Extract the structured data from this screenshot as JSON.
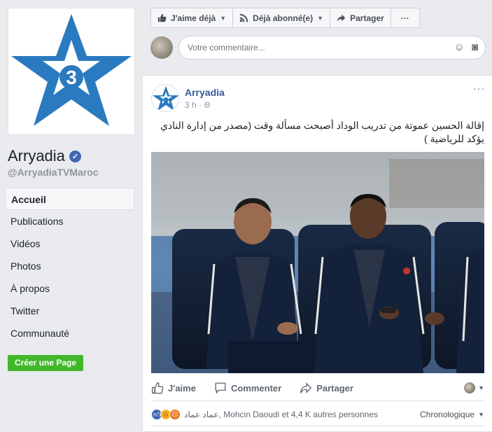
{
  "page": {
    "name": "Arryadia",
    "handle": "@ArryadiaTVMaroc",
    "logo_number": "3",
    "colors": {
      "brand_blue": "#2a7ac0",
      "link_blue": "#365899",
      "green": "#42b72a"
    }
  },
  "nav": {
    "items": [
      {
        "label": "Accueil",
        "active": true
      },
      {
        "label": "Publications"
      },
      {
        "label": "Vidéos"
      },
      {
        "label": "Photos"
      },
      {
        "label": "À propos"
      },
      {
        "label": "Twitter"
      },
      {
        "label": "Communauté"
      }
    ],
    "create_page": "Créer une Page"
  },
  "actionbar": {
    "like": "J'aime déjà",
    "follow": "Déjà abonné(e)",
    "share": "Partager",
    "more": "···"
  },
  "comment_box": {
    "placeholder": "Votre commentaire..."
  },
  "post": {
    "author": "Arryadia",
    "time": "3 h",
    "text": "إقالة الحسين عموتة من تدريب الوداد أصبحت مسألة وقت (مصدر من إدارة النادي يؤكد للرياضية )",
    "actions": {
      "like": "J'aime",
      "comment": "Commenter",
      "share": "Partager"
    },
    "reactions_text": "عماد عماد, Mohcin Daoudi et 4,4 K autres personnes",
    "sort": "Chronologique"
  }
}
